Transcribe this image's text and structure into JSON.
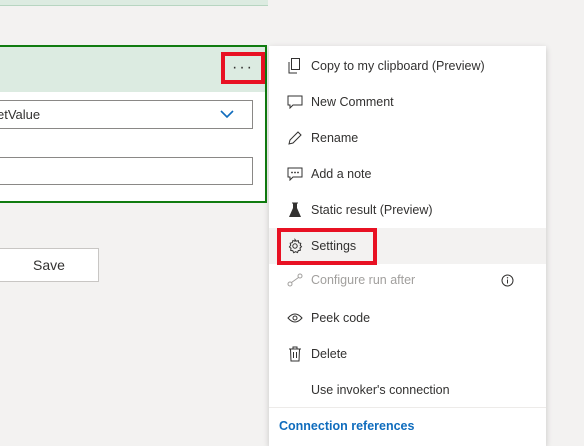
{
  "card": {
    "dropdown_value": "etValue",
    "more_button_label": "···"
  },
  "save_button_label": "Save",
  "menu": {
    "items": [
      {
        "label": "Copy to my clipboard (Preview)",
        "icon": "copy-icon"
      },
      {
        "label": "New Comment",
        "icon": "comment-icon"
      },
      {
        "label": "Rename",
        "icon": "pencil-icon"
      },
      {
        "label": "Add a note",
        "icon": "note-icon"
      },
      {
        "label": "Static result (Preview)",
        "icon": "flask-icon"
      },
      {
        "label": "Settings",
        "icon": "gear-icon"
      },
      {
        "label": "Configure run after",
        "icon": "run-after-icon",
        "disabled": true
      },
      {
        "label": "Peek code",
        "icon": "eye-icon"
      },
      {
        "label": "Delete",
        "icon": "trash-icon"
      },
      {
        "label": "Use invoker's connection",
        "icon": ""
      }
    ],
    "footer_link": "Connection references"
  },
  "colors": {
    "card_border": "#107c10",
    "card_header": "#dcebe1",
    "highlight_box": "#e81123",
    "link": "#0f6cbd"
  }
}
